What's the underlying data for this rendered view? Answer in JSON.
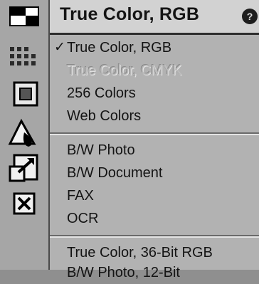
{
  "toolbar": {
    "tools": [
      {
        "icon": "image-type-icon"
      },
      {
        "icon": "halftone-dots-icon"
      },
      {
        "icon": "frame-select-icon"
      },
      {
        "icon": "color-drop-icon"
      },
      {
        "icon": "scale-arrow-icon"
      },
      {
        "icon": "close-box-icon"
      }
    ]
  },
  "header": {
    "title": "True Color, RGB",
    "help_icon": "?"
  },
  "menu": {
    "groups": [
      [
        {
          "label": "True Color, RGB",
          "checked": true,
          "disabled": false
        },
        {
          "label": "True Color, CMYK",
          "checked": false,
          "disabled": true
        },
        {
          "label": "256 Colors",
          "checked": false,
          "disabled": false
        },
        {
          "label": "Web Colors",
          "checked": false,
          "disabled": false
        }
      ],
      [
        {
          "label": "B/W Photo",
          "checked": false,
          "disabled": false
        },
        {
          "label": "B/W Document",
          "checked": false,
          "disabled": false
        },
        {
          "label": "FAX",
          "checked": false,
          "disabled": false
        },
        {
          "label": "OCR",
          "checked": false,
          "disabled": false
        }
      ],
      [
        {
          "label": "True Color, 36-Bit RGB",
          "checked": false,
          "disabled": false
        },
        {
          "label": "B/W Photo, 12-Bit",
          "checked": false,
          "disabled": false
        }
      ]
    ],
    "check_mark": "✓"
  }
}
